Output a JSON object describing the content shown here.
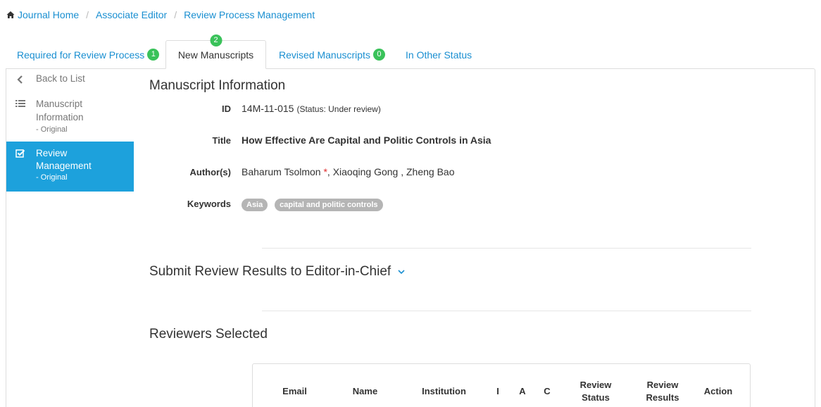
{
  "breadcrumb": {
    "home": "Journal Home",
    "associate": "Associate Editor",
    "current": "Review Process Management"
  },
  "tabs": [
    {
      "label": "Required for Review Process",
      "badge": "1"
    },
    {
      "label": "New Manuscripts",
      "badge": "2"
    },
    {
      "label": "Revised Manuscripts",
      "badge": "0"
    },
    {
      "label": "In Other Status"
    }
  ],
  "sidebar": {
    "back": "Back to List",
    "info_line1": "Manuscript",
    "info_line2": "Information",
    "info_sub": "- Original",
    "review_line1": "Review",
    "review_line2": "Management",
    "review_sub": "- Original"
  },
  "manuscript": {
    "section_title": "Manuscript Information",
    "id_label": "ID",
    "id_value": "14M-11-015",
    "status_note": "(Status: Under review)",
    "title_label": "Title",
    "title_value": "How Effective Are Capital and Politic Controls in Asia",
    "authors_label": "Author(s)",
    "author_1": "Baharum Tsolmon",
    "author_star": "*",
    "authors_rest": ", Xiaoqing Gong , Zheng Bao",
    "keywords_label": "Keywords",
    "keywords": [
      "Asia",
      "capital and politic controls"
    ]
  },
  "submit_section": {
    "title": "Submit Review Results to Editor-in-Chief"
  },
  "reviewers": {
    "title": "Reviewers Selected",
    "columns": [
      "Email",
      "Name",
      "Institution",
      "I",
      "A",
      "C",
      "Review Status",
      "Review Results",
      "Action"
    ]
  },
  "colors": {
    "link": "#1a8fd1",
    "badge": "#3ac25a",
    "active_sidebar": "#1da1dc",
    "keyword_tag": "#b5b5b5",
    "required_star": "#e02b2b"
  },
  "icons": {
    "home": "home-icon",
    "back": "chevron-left-icon",
    "info": "list-icon",
    "review": "checkbox-icon",
    "expand": "chevron-down-icon"
  }
}
